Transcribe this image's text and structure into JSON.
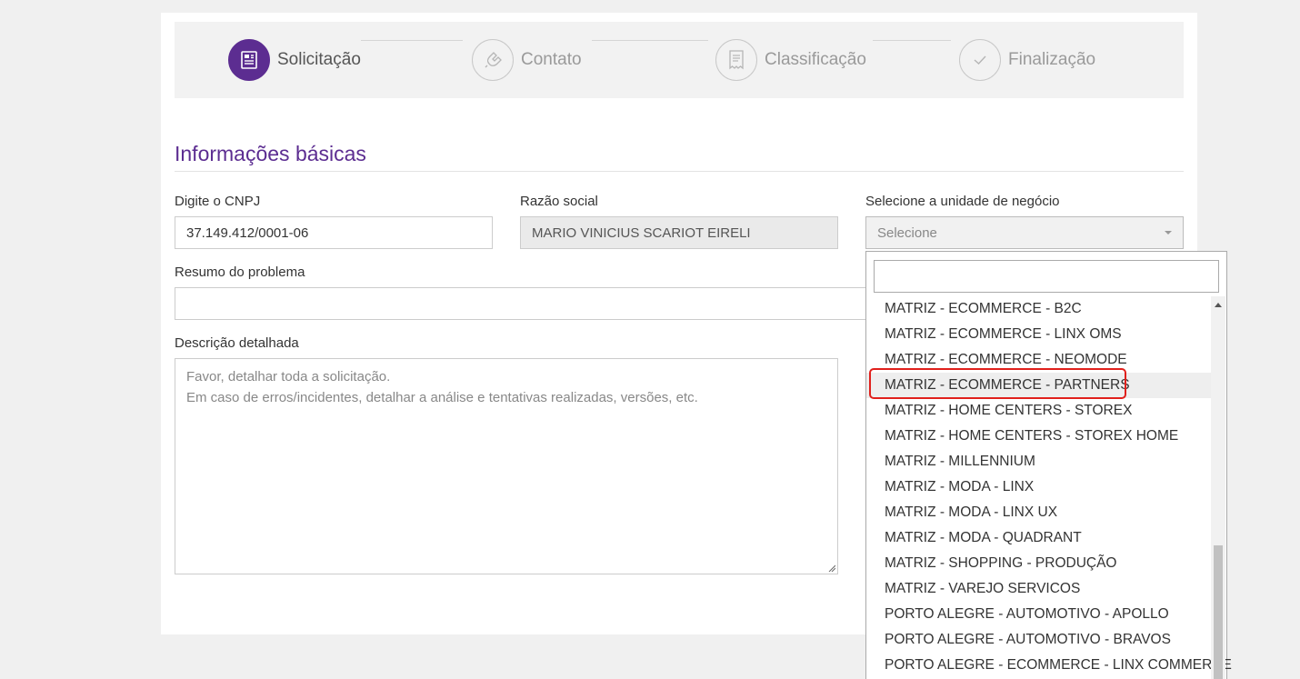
{
  "stepper": {
    "steps": [
      {
        "label": "Solicitação",
        "active": true,
        "icon": "document-icon"
      },
      {
        "label": "Contato",
        "active": false,
        "icon": "phone-icon"
      },
      {
        "label": "Classificação",
        "active": false,
        "icon": "receipt-icon"
      },
      {
        "label": "Finalização",
        "active": false,
        "icon": "check-icon"
      }
    ]
  },
  "section": {
    "title": "Informações básicas"
  },
  "form": {
    "cnpj_label": "Digite o CNPJ",
    "cnpj_value": "37.149.412/0001-06",
    "razao_label": "Razão social",
    "razao_value": "MARIO VINICIUS SCARIOT EIRELI",
    "unidade_label": "Selecione a unidade de negócio",
    "unidade_value": "Selecione",
    "resumo_label": "Resumo do problema",
    "resumo_value": "",
    "descricao_label": "Descrição detalhada",
    "descricao_placeholder_line1": "Favor, detalhar toda a solicitação.",
    "descricao_placeholder_line2": "Em caso de erros/incidentes, detalhar a análise e tentativas realizadas, versões, etc."
  },
  "dropdown": {
    "search_value": "",
    "highlighted_index": 3,
    "items": [
      "MATRIZ - ECOMMERCE - B2C",
      "MATRIZ - ECOMMERCE - LINX OMS",
      "MATRIZ - ECOMMERCE - NEOMODE",
      "MATRIZ - ECOMMERCE - PARTNERS",
      "MATRIZ - HOME CENTERS - STOREX",
      "MATRIZ - HOME CENTERS - STOREX HOME",
      "MATRIZ - MILLENNIUM",
      "MATRIZ - MODA - LINX",
      "MATRIZ - MODA - LINX UX",
      "MATRIZ - MODA - QUADRANT",
      "MATRIZ - SHOPPING - PRODUÇÃO",
      "MATRIZ - VAREJO SERVICOS",
      "PORTO ALEGRE - AUTOMOTIVO - APOLLO",
      "PORTO ALEGRE - AUTOMOTIVO - BRAVOS",
      "PORTO ALEGRE - ECOMMERCE - LINX COMMERCE"
    ]
  },
  "colors": {
    "accent": "#5c2d91",
    "highlight_border": "#e0201c"
  }
}
